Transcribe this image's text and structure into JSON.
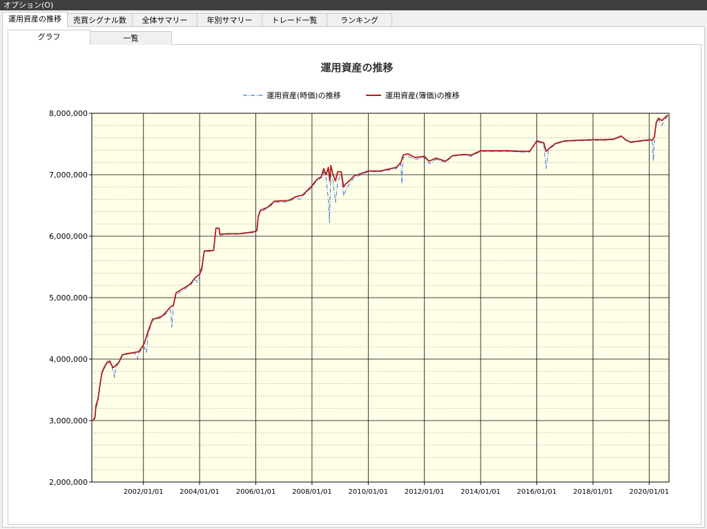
{
  "menu": {
    "options_label": "オプション(O)"
  },
  "main_tabs": [
    "運用資産の推移",
    "売買シグナル数",
    "全体サマリー",
    "年別サマリー",
    "トレード一覧",
    "ランキング"
  ],
  "sub_tabs": [
    "グラフ",
    "一覧"
  ],
  "colors": {
    "plot_background": "#ffffe8",
    "market_value_line": "#3a6fd8",
    "book_value_line": "#b01c1c",
    "major_grid": "#000000",
    "minor_grid": "#a0a0a0"
  },
  "chart_data": {
    "type": "line",
    "title": "運用資産の推移",
    "xlabel": "",
    "ylabel": "",
    "legend_position": "top-center",
    "grid": true,
    "x_range": [
      "2000-03-01",
      "2020-09-15"
    ],
    "ylim": [
      2000000,
      8000000
    ],
    "x_ticks": [
      "2002/01/01",
      "2004/01/01",
      "2006/01/01",
      "2008/01/01",
      "2010/01/01",
      "2012/01/01",
      "2014/01/01",
      "2016/01/01",
      "2018/01/01",
      "2020/01/01"
    ],
    "y_ticks": [
      "2,000,000",
      "3,000,000",
      "4,000,000",
      "5,000,000",
      "6,000,000",
      "7,000,000",
      "8,000,000"
    ],
    "series": [
      {
        "name": "運用資産(時価)の推移",
        "style": "dash-dot",
        "points": [
          [
            "2000-03-01",
            3000000
          ],
          [
            "2000-03-20",
            3010000
          ],
          [
            "2000-04-10",
            3030000
          ],
          [
            "2000-04-25",
            3200000
          ],
          [
            "2000-05-20",
            3300000
          ],
          [
            "2000-06-15",
            3550000
          ],
          [
            "2000-07-10",
            3750000
          ],
          [
            "2000-08-10",
            3850000
          ],
          [
            "2000-09-15",
            3920000
          ],
          [
            "2000-10-20",
            3950000
          ],
          [
            "2000-11-15",
            3880000
          ],
          [
            "2000-12-01",
            3820000
          ],
          [
            "2000-12-20",
            3700000
          ],
          [
            "2001-01-10",
            3880000
          ],
          [
            "2001-02-20",
            3940000
          ],
          [
            "2001-04-01",
            4050000
          ],
          [
            "2001-06-01",
            4080000
          ],
          [
            "2001-08-01",
            4090000
          ],
          [
            "2001-09-10",
            4100000
          ],
          [
            "2001-10-15",
            4000000
          ],
          [
            "2001-11-01",
            4100000
          ],
          [
            "2002-01-10",
            4200000
          ],
          [
            "2002-02-10",
            4100000
          ],
          [
            "2002-03-01",
            4400000
          ],
          [
            "2002-05-01",
            4630000
          ],
          [
            "2002-07-01",
            4650000
          ],
          [
            "2002-09-01",
            4680000
          ],
          [
            "2002-11-01",
            4750000
          ],
          [
            "2002-12-20",
            4800000
          ],
          [
            "2003-01-05",
            4520000
          ],
          [
            "2003-01-25",
            4850000
          ],
          [
            "2003-03-01",
            5050000
          ],
          [
            "2003-06-01",
            5120000
          ],
          [
            "2003-09-01",
            5200000
          ],
          [
            "2003-11-01",
            5300000
          ],
          [
            "2003-12-01",
            5250000
          ],
          [
            "2004-01-01",
            5350000
          ],
          [
            "2004-02-01",
            5450000
          ],
          [
            "2004-03-01",
            5750000
          ],
          [
            "2004-05-01",
            5750000
          ],
          [
            "2004-07-01",
            5760000
          ],
          [
            "2004-08-01",
            6120000
          ],
          [
            "2004-09-10",
            6120000
          ],
          [
            "2004-09-20",
            6020000
          ],
          [
            "2005-01-01",
            6030000
          ],
          [
            "2005-06-01",
            6030000
          ],
          [
            "2005-12-01",
            6060000
          ],
          [
            "2006-01-15",
            6080000
          ],
          [
            "2006-02-01",
            6300000
          ],
          [
            "2006-03-01",
            6400000
          ],
          [
            "2006-06-01",
            6450000
          ],
          [
            "2006-09-01",
            6550000
          ],
          [
            "2007-03-01",
            6560000
          ],
          [
            "2007-06-01",
            6620000
          ],
          [
            "2007-08-01",
            6600000
          ],
          [
            "2007-09-01",
            6650000
          ],
          [
            "2008-01-01",
            6800000
          ],
          [
            "2008-03-01",
            6900000
          ],
          [
            "2008-05-01",
            6950000
          ],
          [
            "2008-06-01",
            7050000
          ],
          [
            "2008-07-01",
            6950000
          ],
          [
            "2008-08-01",
            6600000
          ],
          [
            "2008-08-15",
            6220000
          ],
          [
            "2008-09-01",
            7000000
          ],
          [
            "2008-10-01",
            6900000
          ],
          [
            "2008-11-01",
            6550000
          ],
          [
            "2008-12-01",
            6900000
          ],
          [
            "2009-01-15",
            7000000
          ],
          [
            "2009-02-15",
            6650000
          ],
          [
            "2009-03-15",
            6750000
          ],
          [
            "2009-05-01",
            6850000
          ],
          [
            "2009-07-01",
            6950000
          ],
          [
            "2009-10-01",
            7000000
          ],
          [
            "2010-01-01",
            7050000
          ],
          [
            "2010-06-01",
            7050000
          ],
          [
            "2011-01-01",
            7100000
          ],
          [
            "2011-03-01",
            7180000
          ],
          [
            "2011-03-15",
            6850000
          ],
          [
            "2011-04-01",
            7280000
          ],
          [
            "2011-06-01",
            7300000
          ],
          [
            "2011-09-01",
            7250000
          ],
          [
            "2012-01-01",
            7280000
          ],
          [
            "2012-03-01",
            7180000
          ],
          [
            "2012-06-01",
            7250000
          ],
          [
            "2012-10-01",
            7200000
          ],
          [
            "2013-01-01",
            7300000
          ],
          [
            "2013-06-01",
            7320000
          ],
          [
            "2013-09-01",
            7300000
          ],
          [
            "2014-01-01",
            7380000
          ],
          [
            "2014-06-01",
            7380000
          ],
          [
            "2015-01-01",
            7380000
          ],
          [
            "2015-06-01",
            7370000
          ],
          [
            "2015-10-01",
            7370000
          ],
          [
            "2016-01-01",
            7540000
          ],
          [
            "2016-04-01",
            7500000
          ],
          [
            "2016-05-01",
            7100000
          ],
          [
            "2016-06-01",
            7400000
          ],
          [
            "2016-09-01",
            7500000
          ],
          [
            "2017-01-01",
            7540000
          ],
          [
            "2017-06-01",
            7550000
          ],
          [
            "2018-01-01",
            7560000
          ],
          [
            "2018-06-01",
            7560000
          ],
          [
            "2018-10-01",
            7570000
          ],
          [
            "2019-01-01",
            7620000
          ],
          [
            "2019-03-01",
            7560000
          ],
          [
            "2019-05-01",
            7520000
          ],
          [
            "2019-09-01",
            7540000
          ],
          [
            "2020-01-15",
            7560000
          ],
          [
            "2020-02-10",
            7550000
          ],
          [
            "2020-02-25",
            7220000
          ],
          [
            "2020-03-10",
            7600000
          ],
          [
            "2020-04-01",
            7800000
          ],
          [
            "2020-05-01",
            7900000
          ],
          [
            "2020-06-15",
            7800000
          ],
          [
            "2020-07-15",
            7880000
          ],
          [
            "2020-09-01",
            7960000
          ]
        ]
      },
      {
        "name": "運用資産(簿価)の推移",
        "style": "solid",
        "points": [
          [
            "2000-03-01",
            3000000
          ],
          [
            "2000-03-20",
            3010000
          ],
          [
            "2000-04-10",
            3050000
          ],
          [
            "2000-04-25",
            3250000
          ],
          [
            "2000-05-20",
            3350000
          ],
          [
            "2000-06-15",
            3580000
          ],
          [
            "2000-07-10",
            3780000
          ],
          [
            "2000-08-10",
            3870000
          ],
          [
            "2000-09-15",
            3950000
          ],
          [
            "2000-10-20",
            3970000
          ],
          [
            "2000-11-15",
            3900000
          ],
          [
            "2000-12-01",
            3860000
          ],
          [
            "2001-01-10",
            3900000
          ],
          [
            "2001-02-20",
            3960000
          ],
          [
            "2001-04-01",
            4070000
          ],
          [
            "2001-06-01",
            4090000
          ],
          [
            "2001-08-01",
            4100000
          ],
          [
            "2001-09-10",
            4110000
          ],
          [
            "2001-11-01",
            4120000
          ],
          [
            "2002-01-10",
            4250000
          ],
          [
            "2002-03-01",
            4450000
          ],
          [
            "2002-05-01",
            4650000
          ],
          [
            "2002-07-01",
            4670000
          ],
          [
            "2002-09-01",
            4700000
          ],
          [
            "2002-11-01",
            4780000
          ],
          [
            "2002-12-20",
            4850000
          ],
          [
            "2003-01-25",
            4880000
          ],
          [
            "2003-03-01",
            5080000
          ],
          [
            "2003-06-01",
            5150000
          ],
          [
            "2003-09-01",
            5220000
          ],
          [
            "2003-11-01",
            5320000
          ],
          [
            "2004-01-01",
            5380000
          ],
          [
            "2004-02-01",
            5500000
          ],
          [
            "2004-03-01",
            5760000
          ],
          [
            "2004-07-01",
            5770000
          ],
          [
            "2004-08-01",
            6130000
          ],
          [
            "2004-09-10",
            6130000
          ],
          [
            "2004-09-20",
            6030000
          ],
          [
            "2005-01-01",
            6040000
          ],
          [
            "2005-06-01",
            6040000
          ],
          [
            "2005-12-01",
            6070000
          ],
          [
            "2006-01-15",
            6090000
          ],
          [
            "2006-02-01",
            6320000
          ],
          [
            "2006-03-01",
            6420000
          ],
          [
            "2006-06-01",
            6470000
          ],
          [
            "2006-09-01",
            6570000
          ],
          [
            "2007-03-01",
            6580000
          ],
          [
            "2007-06-01",
            6640000
          ],
          [
            "2007-09-01",
            6670000
          ],
          [
            "2008-01-01",
            6820000
          ],
          [
            "2008-03-01",
            6920000
          ],
          [
            "2008-05-01",
            6970000
          ],
          [
            "2008-06-01",
            7100000
          ],
          [
            "2008-07-01",
            7000000
          ],
          [
            "2008-08-01",
            7120000
          ],
          [
            "2008-08-20",
            6900000
          ],
          [
            "2008-09-01",
            7150000
          ],
          [
            "2008-10-01",
            7000000
          ],
          [
            "2008-11-01",
            6900000
          ],
          [
            "2008-12-01",
            7050000
          ],
          [
            "2009-01-15",
            7050000
          ],
          [
            "2009-02-15",
            6800000
          ],
          [
            "2009-03-15",
            6850000
          ],
          [
            "2009-05-01",
            6900000
          ],
          [
            "2009-07-01",
            6980000
          ],
          [
            "2009-10-01",
            7020000
          ],
          [
            "2010-01-01",
            7060000
          ],
          [
            "2010-06-01",
            7060000
          ],
          [
            "2011-01-01",
            7120000
          ],
          [
            "2011-03-01",
            7200000
          ],
          [
            "2011-04-01",
            7320000
          ],
          [
            "2011-06-01",
            7340000
          ],
          [
            "2011-09-01",
            7280000
          ],
          [
            "2012-01-01",
            7300000
          ],
          [
            "2012-03-01",
            7220000
          ],
          [
            "2012-06-01",
            7270000
          ],
          [
            "2012-10-01",
            7220000
          ],
          [
            "2013-01-01",
            7310000
          ],
          [
            "2013-06-01",
            7330000
          ],
          [
            "2013-09-01",
            7320000
          ],
          [
            "2014-01-01",
            7390000
          ],
          [
            "2014-06-01",
            7390000
          ],
          [
            "2015-01-01",
            7390000
          ],
          [
            "2015-06-01",
            7380000
          ],
          [
            "2015-10-01",
            7380000
          ],
          [
            "2016-01-01",
            7550000
          ],
          [
            "2016-04-01",
            7520000
          ],
          [
            "2016-05-01",
            7380000
          ],
          [
            "2016-06-01",
            7420000
          ],
          [
            "2016-09-01",
            7510000
          ],
          [
            "2017-01-01",
            7550000
          ],
          [
            "2017-06-01",
            7560000
          ],
          [
            "2018-01-01",
            7570000
          ],
          [
            "2018-06-01",
            7570000
          ],
          [
            "2018-10-01",
            7580000
          ],
          [
            "2019-01-01",
            7630000
          ],
          [
            "2019-03-01",
            7570000
          ],
          [
            "2019-05-01",
            7530000
          ],
          [
            "2019-09-01",
            7550000
          ],
          [
            "2020-01-15",
            7570000
          ],
          [
            "2020-02-10",
            7560000
          ],
          [
            "2020-03-10",
            7620000
          ],
          [
            "2020-04-01",
            7850000
          ],
          [
            "2020-05-01",
            7920000
          ],
          [
            "2020-06-15",
            7880000
          ],
          [
            "2020-07-15",
            7920000
          ],
          [
            "2020-09-01",
            7970000
          ]
        ]
      }
    ]
  }
}
